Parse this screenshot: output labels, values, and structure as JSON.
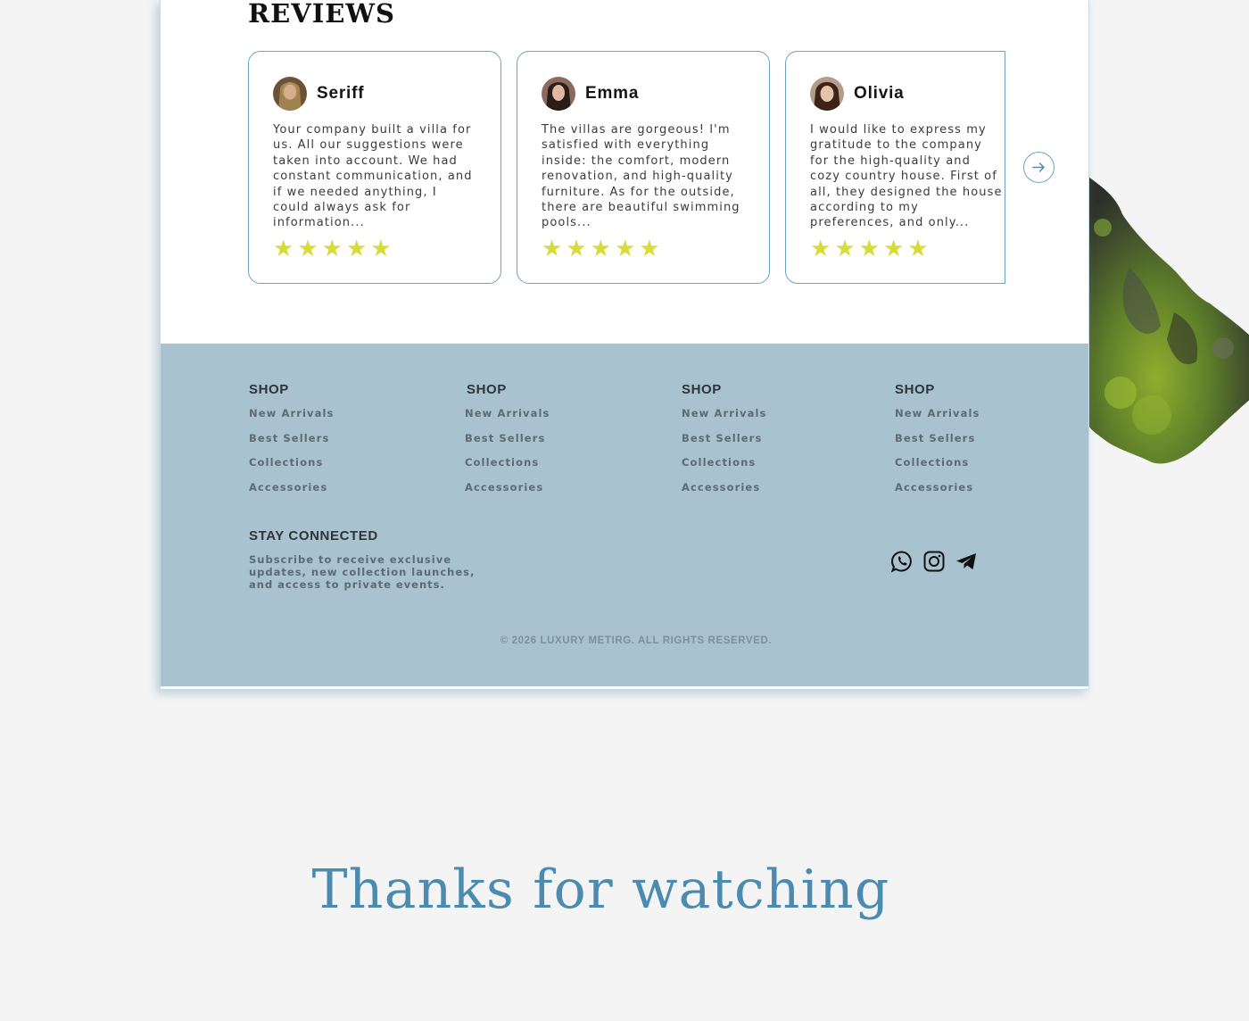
{
  "reviews": {
    "title": "REVIEWS",
    "items": [
      {
        "name": "Seriff",
        "text": "Your company built a villa for\nus. All our suggestions were\ntaken into account. We had\nconstant communication, and\nif we needed anything, I\ncould always ask for\ninformation...",
        "rating": 5,
        "stars": "★★★★★"
      },
      {
        "name": "Emma",
        "text": "The villas are gorgeous! I'm\nsatisfied with everything\ninside: the comfort, modern\nrenovation, and high-quality\nfurniture. As for the outside,\nthere are beautiful swimming\npools...",
        "rating": 5,
        "stars": "★★★★★"
      },
      {
        "name": "Olivia",
        "text": "I would like to express my\ngratitude to the company\nfor the high-quality and\ncozy country house. First of\nall, they designed the house\naccording to my\npreferences, and only...",
        "rating": 5,
        "stars": "★★★★★"
      }
    ],
    "next_icon": "arrow-right-icon"
  },
  "footer": {
    "columns": [
      {
        "title": "SHOP",
        "links": [
          "New  Arrivals",
          "Best Sellers",
          "Collections",
          "Accessories"
        ]
      },
      {
        "title": "SHOP",
        "links": [
          "New  Arrivals",
          "Best Sellers",
          "Collections",
          "Accessories"
        ]
      },
      {
        "title": "SHOP",
        "links": [
          "New  Arrivals",
          "Best Sellers",
          "Collections",
          "Accessories"
        ]
      },
      {
        "title": "SHOP",
        "links": [
          "New  Arrivals",
          "Best Sellers",
          "Collections",
          "Accessories"
        ]
      }
    ],
    "stay_title": "STAY CONNECTED",
    "stay_text": "Subscribe to receive exclusive updates, new collection launches, and access to private events.",
    "social_icons": [
      "whatsapp-icon",
      "instagram-icon",
      "telegram-icon"
    ],
    "copyright": "© 2026 LUXURY METIRG. ALL RIGHTS RESERVED."
  },
  "thanks": "Thanks for watching",
  "colors": {
    "accent": "#4b8bb0",
    "card_border": "#6ea2c1",
    "star": "#d7dc3a",
    "footer_bg": "#a9c2cf",
    "page_bg": "#f4f4f4"
  }
}
